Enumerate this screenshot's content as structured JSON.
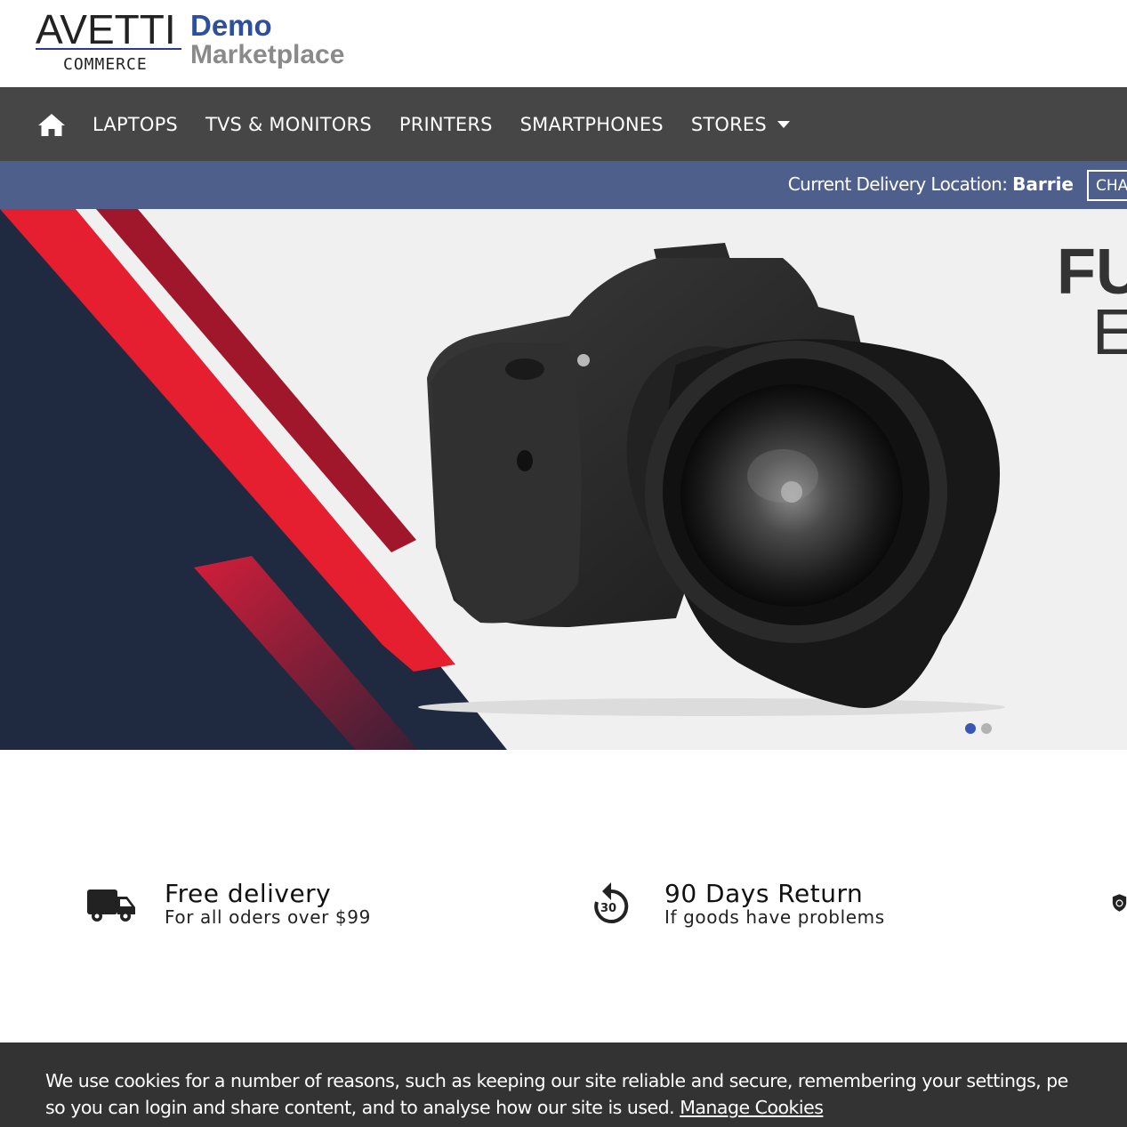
{
  "header": {
    "brand": "AVETTI",
    "brand_sub": "COMMERCE",
    "site_line1": "Demo",
    "site_line2": "Marketplace"
  },
  "nav": {
    "home_icon": "home-icon",
    "items": [
      {
        "label": "LAPTOPS"
      },
      {
        "label": "TVS & MONITORS"
      },
      {
        "label": "PRINTERS"
      },
      {
        "label": "SMARTPHONES"
      },
      {
        "label": "STORES",
        "has_dropdown": true
      }
    ]
  },
  "delivery": {
    "label": "Current Delivery Location:",
    "location": "Barrie",
    "change_label": "CHA"
  },
  "hero": {
    "headline": "FU",
    "subline": "E",
    "slides_count": 2,
    "active_slide": 1,
    "colors": {
      "navy": "#1f2940",
      "red": "#e51f2f",
      "dark_red": "#a0162a"
    }
  },
  "features": [
    {
      "icon": "truck-icon",
      "title": "Free delivery",
      "subtitle": "For all oders over $99"
    },
    {
      "icon": "return-30-icon",
      "icon_text": "30",
      "title": "90 Days Return",
      "subtitle": "If goods have problems"
    },
    {
      "icon": "shield-icon"
    }
  ],
  "cookie": {
    "line1": "We use cookies for a number of reasons, such as keeping our site reliable and secure, remembering your settings, pe",
    "line2": "so you can login and share content, and to analyse how our site is used.",
    "link": "Manage Cookies"
  }
}
